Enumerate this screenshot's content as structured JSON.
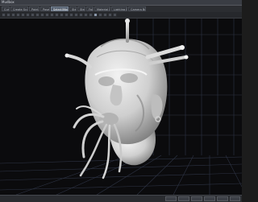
{
  "window": {
    "title": "Mudbox"
  },
  "tabs": [
    {
      "label": "Curves"
    },
    {
      "label": "Create Sculpt Tools"
    },
    {
      "label": "Paint Tools"
    },
    {
      "label": "Pose Tools"
    },
    {
      "label": "Select/Move Tools"
    },
    {
      "label": "Stamp"
    },
    {
      "label": "Stencil"
    },
    {
      "label": "Falloff"
    },
    {
      "label": "Material Presets"
    },
    {
      "label": "Lighting Presets"
    },
    {
      "label": "Camera Bookmarks"
    }
  ],
  "active_tab_index": 4,
  "viewport": {
    "model": "Alien head sculpt with tentacles and tubes",
    "background_color": "#0b0b0d",
    "grid_color": "#2e3445"
  },
  "colors": {
    "accent": "#7a8696",
    "model_base": "#d9d9d9",
    "grid_line": "#2e3445"
  }
}
